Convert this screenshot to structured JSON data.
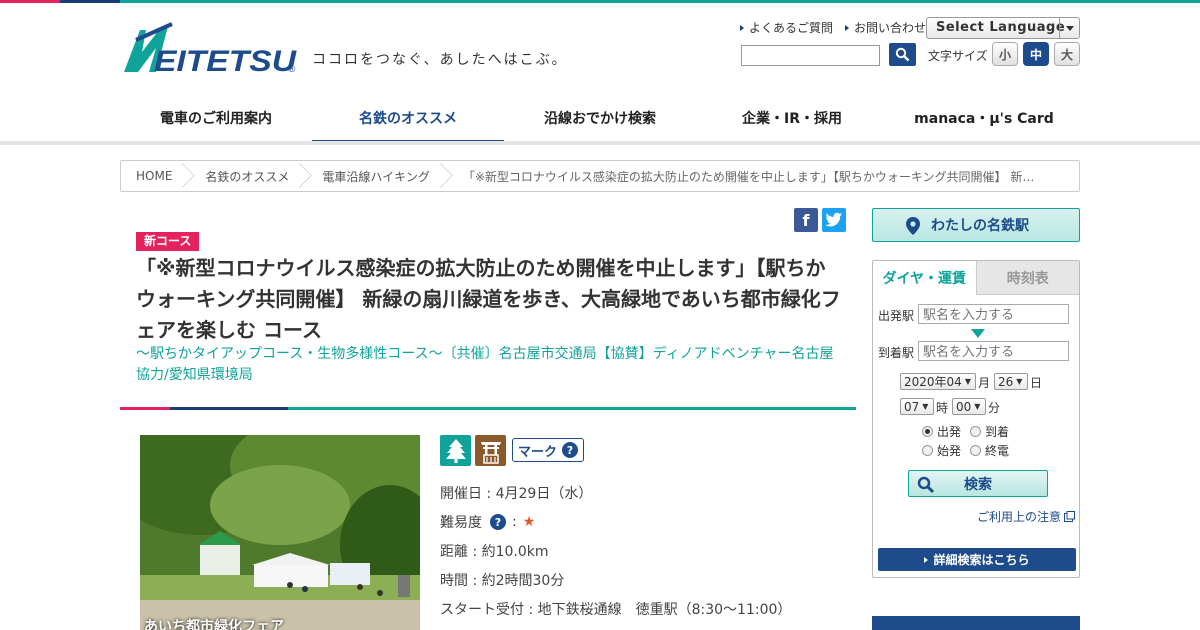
{
  "brand": {
    "logo_text": "MEITETSU",
    "tagline": "ココロをつなぐ、あしたへはこぶ。",
    "colors": {
      "navy": "#1d4b8c",
      "teal": "#10a39a",
      "pink": "#e4235e"
    }
  },
  "header": {
    "util_links": [
      {
        "label": "よくあるご質問"
      },
      {
        "label": "お問い合わせ"
      }
    ],
    "language_select": "Select Language",
    "fontsize_label": "文字サイズ",
    "fontsize_buttons": [
      {
        "label": "小"
      },
      {
        "label": "中",
        "active": true
      },
      {
        "label": "大"
      }
    ]
  },
  "gnav": [
    {
      "label": "電車のご利用案内"
    },
    {
      "label": "名鉄のオススメ",
      "active": true
    },
    {
      "label": "沿線おでかけ検索"
    },
    {
      "label": "企業・IR・採用"
    },
    {
      "label": "manaca・μ's Card"
    }
  ],
  "breadcrumb": [
    {
      "label": "HOME"
    },
    {
      "label": "名鉄のオススメ"
    },
    {
      "label": "電車沿線ハイキング"
    },
    {
      "label": "「※新型コロナウイルス感染症の拡大防止のため開催を中止します」【駅ちかウォーキング共同開催】 新…"
    }
  ],
  "article": {
    "badge": "新コース",
    "title": "「※新型コロナウイルス感染症の拡大防止のため開催を中止します」【駅ちかウォーキング共同開催】 新緑の扇川緑道を歩き、大高緑地であいち都市緑化フェアを楽しむ コース",
    "subtitle": "～駅ちかタイアップコース・生物多様性コース～〔共催〕名古屋市交通局【協賛】ディノアドベンチャー名古屋　協力/愛知県環境局",
    "photo_caption": "あいち都市緑化フェア",
    "mark_button": "マーク",
    "info": {
      "date": "開催日 : 4月29日（水）",
      "difficulty_label": "難易度",
      "difficulty_sep": ":",
      "difficulty_stars": "★",
      "distance": "距離 : 約10.0km",
      "time": "時間 : 約2時間30分",
      "start": "スタート受付 : 地下鉄桜通線　徳重駅（8:30～11:00）"
    }
  },
  "sidebar": {
    "my_meitetsu": "わたしの名鉄駅",
    "tabs": [
      {
        "label": "ダイヤ・運賃"
      },
      {
        "label": "時刻表"
      }
    ],
    "from_label": "出発駅",
    "to_label": "到着駅",
    "station_placeholder": "駅名を入力する",
    "year_month": "2020年04",
    "month_unit": "月",
    "day": "26",
    "day_unit": "日",
    "hour": "07",
    "hour_unit": "時",
    "minute": "00",
    "minute_unit": "分",
    "radios": [
      {
        "label": "出発",
        "checked": true
      },
      {
        "label": "到着"
      },
      {
        "label": "始発"
      },
      {
        "label": "終電"
      }
    ],
    "search_button": "検索",
    "note_link": "ご利用上の注意",
    "detail_button": "詳細検索はこちら"
  }
}
